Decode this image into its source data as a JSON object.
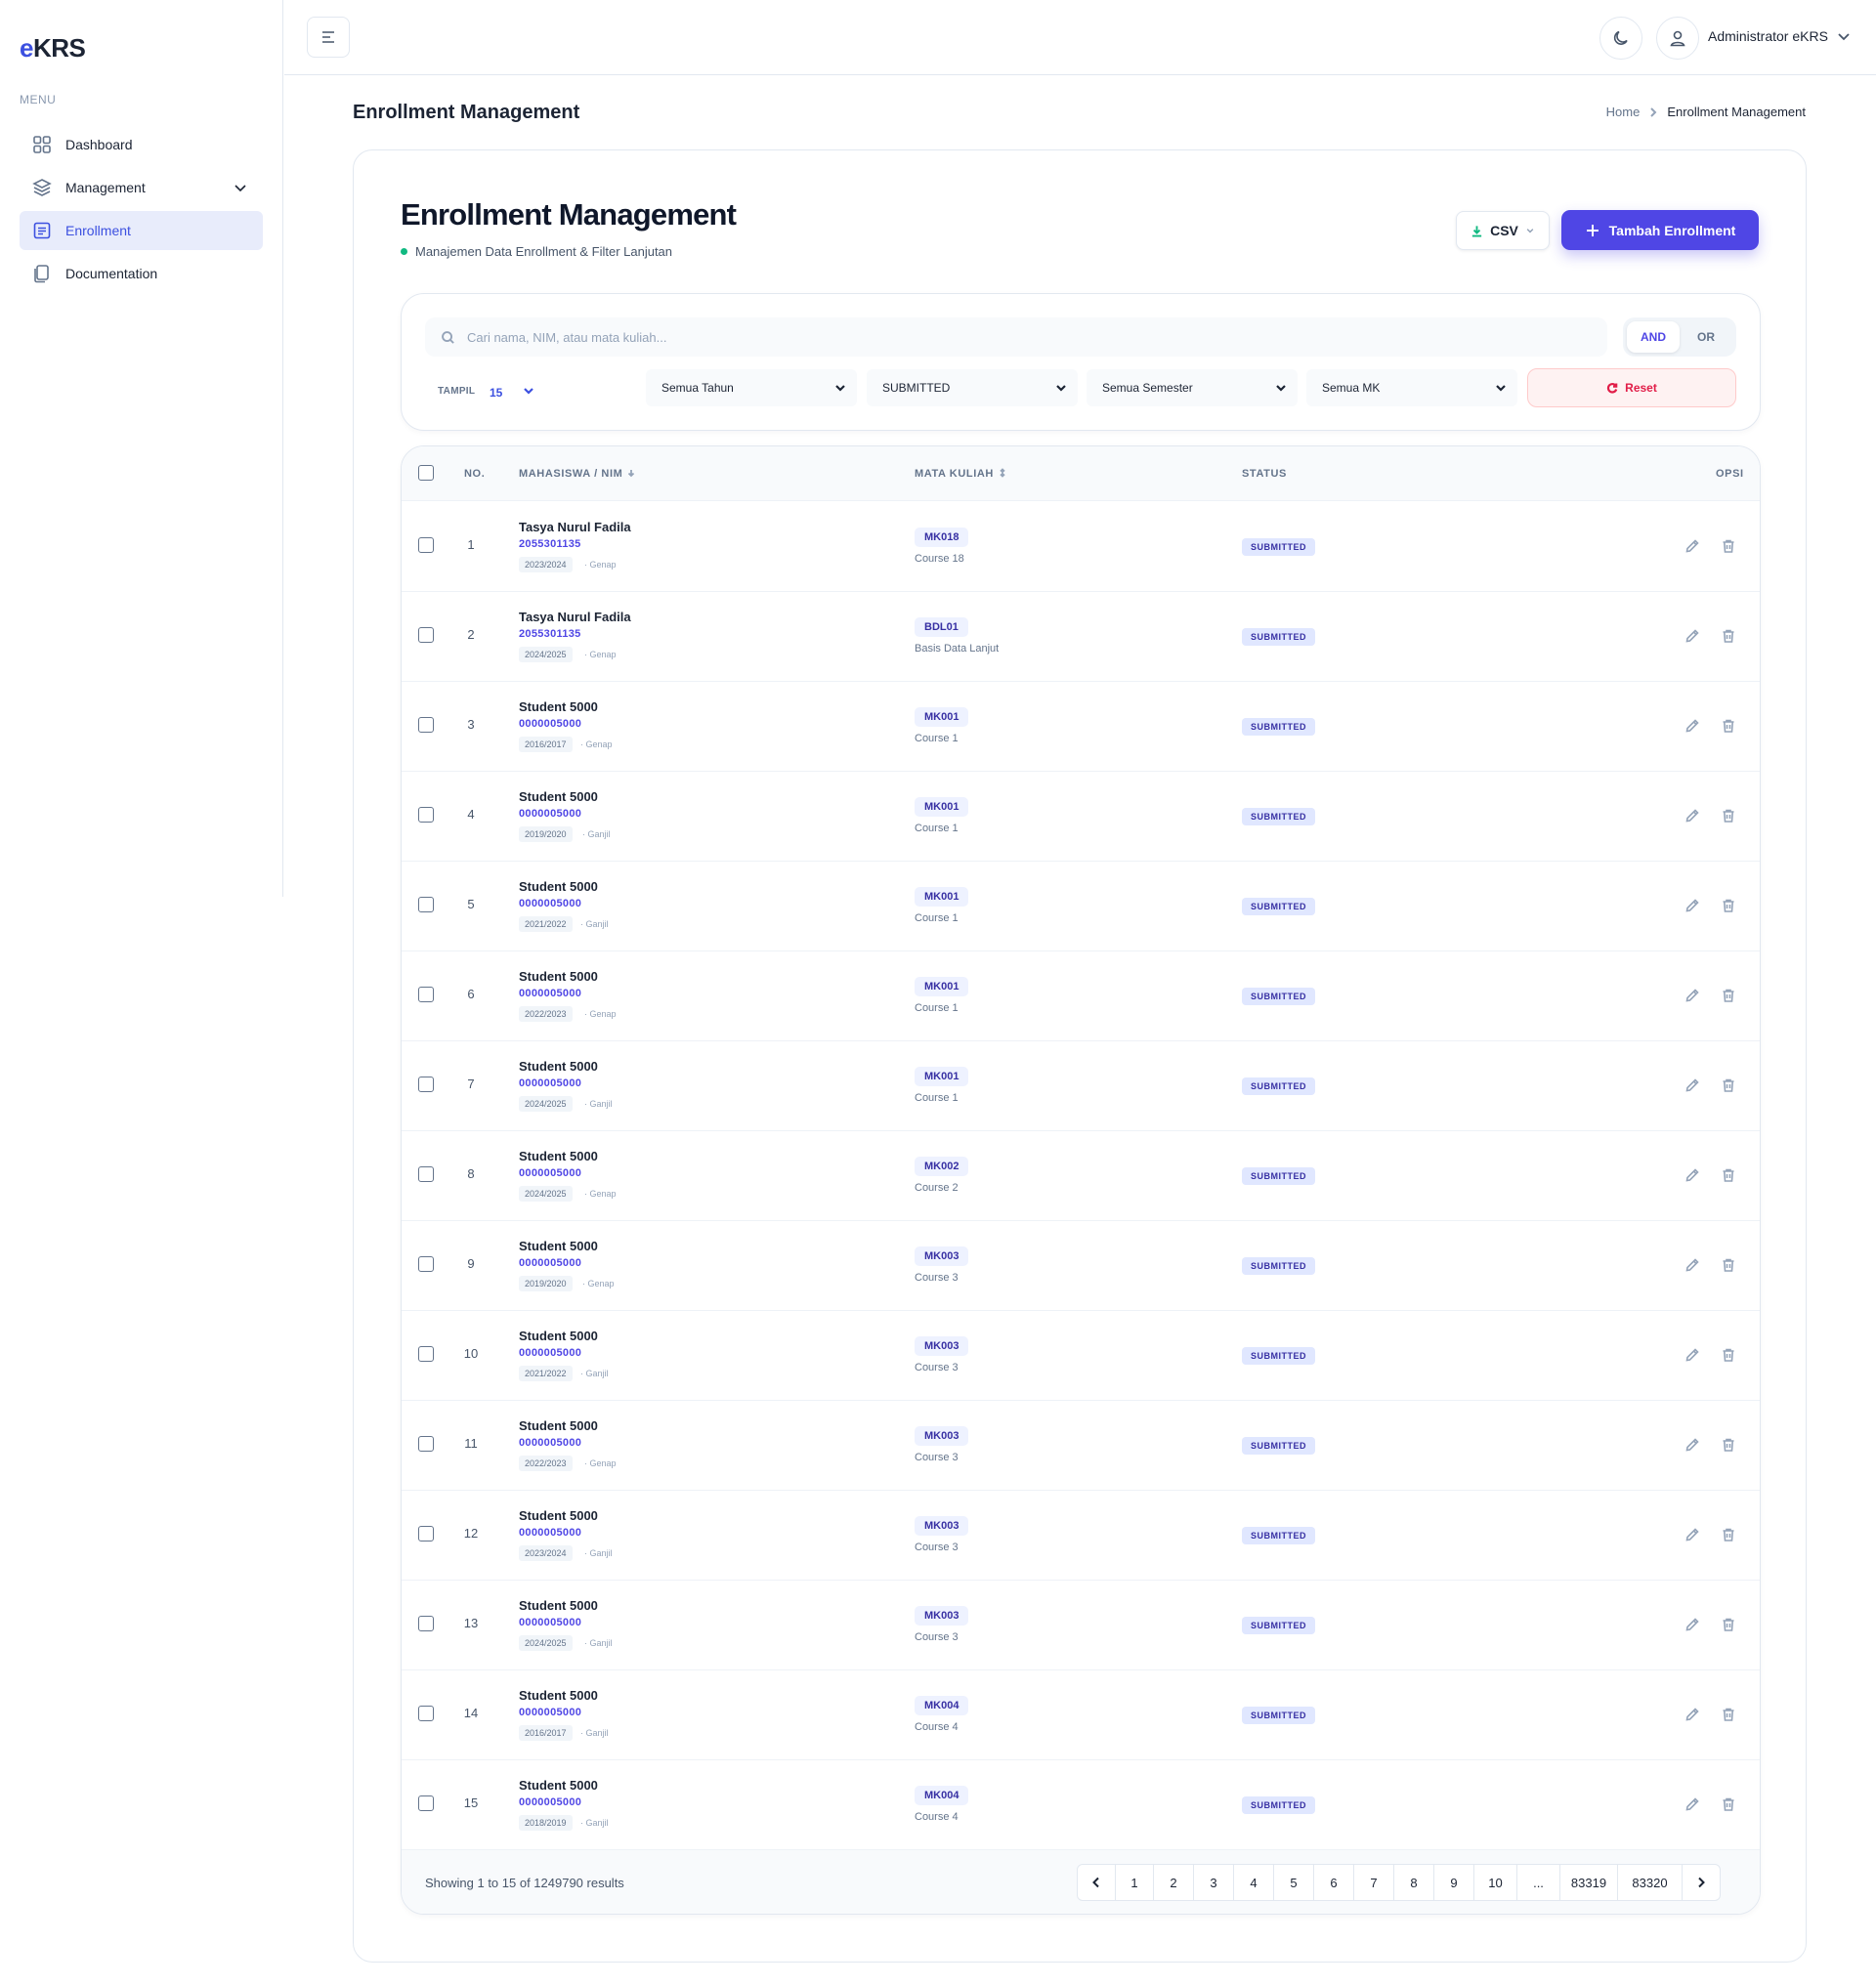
{
  "app": {
    "logo_prefix": "e",
    "logo_rest": "KRS"
  },
  "sidebar": {
    "menu_title": "MENU",
    "items": [
      {
        "label": "Dashboard",
        "icon": "grid-icon"
      },
      {
        "label": "Management",
        "icon": "layers-icon"
      },
      {
        "label": "Enrollment",
        "icon": "list-icon",
        "active": true
      },
      {
        "label": "Documentation",
        "icon": "copy-icon"
      }
    ]
  },
  "header": {
    "user_name": "Administrator eKRS"
  },
  "page": {
    "title": "Enrollment Management",
    "breadcrumb": {
      "home": "Home",
      "current": "Enrollment Management"
    }
  },
  "card": {
    "title": "Enrollment Management",
    "subtitle": "Manajemen Data Enrollment & Filter Lanjutan",
    "csv_label": "CSV",
    "add_label": "Tambah Enrollment"
  },
  "filters": {
    "search_placeholder": "Cari nama, NIM, atau mata kuliah...",
    "logic_and": "AND",
    "logic_or": "OR",
    "tampil_label": "TAMPIL",
    "tampil_value": "15",
    "year": "Semua Tahun",
    "status": "SUBMITTED",
    "semester": "Semua Semester",
    "course": "Semua MK",
    "reset_label": "Reset"
  },
  "table": {
    "headers": {
      "no": "NO.",
      "student": "MAHASISWA / NIM",
      "course": "MATA KULIAH",
      "status": "STATUS",
      "options": "OPSI"
    },
    "rows": [
      {
        "no": "1",
        "name": "Tasya Nurul Fadila",
        "nim": "2055301135",
        "year": "2023/2024",
        "sem": "· Genap",
        "mk": "MK018",
        "course": "Course 18",
        "status": "SUBMITTED"
      },
      {
        "no": "2",
        "name": "Tasya Nurul Fadila",
        "nim": "2055301135",
        "year": "2024/2025",
        "sem": "· Genap",
        "mk": "BDL01",
        "course": "Basis Data Lanjut",
        "status": "SUBMITTED"
      },
      {
        "no": "3",
        "name": "Student 5000",
        "nim": "0000005000",
        "year": "2016/2017",
        "sem": "· Genap",
        "mk": "MK001",
        "course": "Course 1",
        "status": "SUBMITTED"
      },
      {
        "no": "4",
        "name": "Student 5000",
        "nim": "0000005000",
        "year": "2019/2020",
        "sem": "· Ganjil",
        "mk": "MK001",
        "course": "Course 1",
        "status": "SUBMITTED"
      },
      {
        "no": "5",
        "name": "Student 5000",
        "nim": "0000005000",
        "year": "2021/2022",
        "sem": "· Ganjil",
        "mk": "MK001",
        "course": "Course 1",
        "status": "SUBMITTED"
      },
      {
        "no": "6",
        "name": "Student 5000",
        "nim": "0000005000",
        "year": "2022/2023",
        "sem": "· Genap",
        "mk": "MK001",
        "course": "Course 1",
        "status": "SUBMITTED"
      },
      {
        "no": "7",
        "name": "Student 5000",
        "nim": "0000005000",
        "year": "2024/2025",
        "sem": "· Ganjil",
        "mk": "MK001",
        "course": "Course 1",
        "status": "SUBMITTED"
      },
      {
        "no": "8",
        "name": "Student 5000",
        "nim": "0000005000",
        "year": "2024/2025",
        "sem": "· Genap",
        "mk": "MK002",
        "course": "Course 2",
        "status": "SUBMITTED"
      },
      {
        "no": "9",
        "name": "Student 5000",
        "nim": "0000005000",
        "year": "2019/2020",
        "sem": "· Genap",
        "mk": "MK003",
        "course": "Course 3",
        "status": "SUBMITTED"
      },
      {
        "no": "10",
        "name": "Student 5000",
        "nim": "0000005000",
        "year": "2021/2022",
        "sem": "· Ganjil",
        "mk": "MK003",
        "course": "Course 3",
        "status": "SUBMITTED"
      },
      {
        "no": "11",
        "name": "Student 5000",
        "nim": "0000005000",
        "year": "2022/2023",
        "sem": "· Genap",
        "mk": "MK003",
        "course": "Course 3",
        "status": "SUBMITTED"
      },
      {
        "no": "12",
        "name": "Student 5000",
        "nim": "0000005000",
        "year": "2023/2024",
        "sem": "· Ganjil",
        "mk": "MK003",
        "course": "Course 3",
        "status": "SUBMITTED"
      },
      {
        "no": "13",
        "name": "Student 5000",
        "nim": "0000005000",
        "year": "2024/2025",
        "sem": "· Ganjil",
        "mk": "MK003",
        "course": "Course 3",
        "status": "SUBMITTED"
      },
      {
        "no": "14",
        "name": "Student 5000",
        "nim": "0000005000",
        "year": "2016/2017",
        "sem": "· Ganjil",
        "mk": "MK004",
        "course": "Course 4",
        "status": "SUBMITTED"
      },
      {
        "no": "15",
        "name": "Student 5000",
        "nim": "0000005000",
        "year": "2018/2019",
        "sem": "· Ganjil",
        "mk": "MK004",
        "course": "Course 4",
        "status": "SUBMITTED"
      }
    ]
  },
  "pagination": {
    "showing": "Showing 1 to 15 of 1249790 results",
    "pages": [
      "1",
      "2",
      "3",
      "4",
      "5",
      "6",
      "7",
      "8",
      "9",
      "10",
      "...",
      "83319",
      "83320"
    ]
  },
  "colors": {
    "accent": "#4f46e5",
    "brand": "#3c50e0",
    "danger": "#e11d48",
    "success": "#10b981"
  }
}
